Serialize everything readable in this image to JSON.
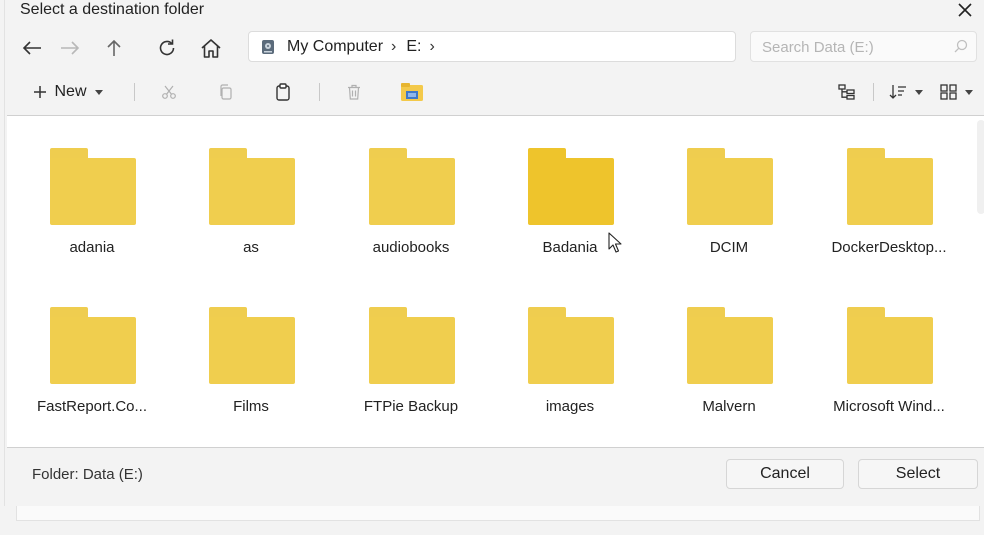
{
  "window": {
    "title": "Select a destination folder"
  },
  "address": {
    "crumbs": [
      "My Computer",
      "E:"
    ],
    "separator": "›"
  },
  "search": {
    "placeholder": "Search Data (E:)",
    "value": ""
  },
  "toolbar": {
    "new_label": "New"
  },
  "folders": [
    {
      "name": "adania"
    },
    {
      "name": "as"
    },
    {
      "name": "audiobooks"
    },
    {
      "name": "Badania"
    },
    {
      "name": "DCIM"
    },
    {
      "name": "DockerDesktop..."
    },
    {
      "name": "FastReport.Co..."
    },
    {
      "name": "Films"
    },
    {
      "name": "FTPie Backup"
    },
    {
      "name": "images"
    },
    {
      "name": "Malvern"
    },
    {
      "name": "Microsoft Wind..."
    }
  ],
  "footer": {
    "folder_label": "Folder: Data (E:)",
    "cancel_label": "Cancel",
    "select_label": "Select"
  },
  "colors": {
    "folder": "#f0ce4e",
    "folder_hover": "#eec42c"
  }
}
